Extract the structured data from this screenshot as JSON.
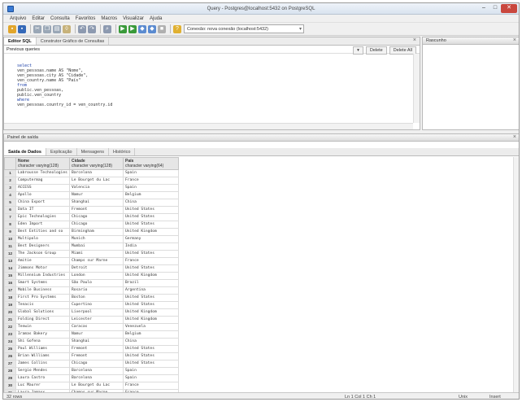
{
  "window": {
    "title": "Query - Postgres@localhost:5432 on PostgreSQL"
  },
  "menu": [
    "Arquivo",
    "Editar",
    "Consulta",
    "Favoritos",
    "Macros",
    "Visualizar",
    "Ajuda"
  ],
  "toolbar": {
    "connection": "Conexão: nova conexão (localhost:5432)"
  },
  "editor": {
    "header": "Editor SQL",
    "tabs": [
      "Editor SQL",
      "Construtor Gráfico de Consultas"
    ],
    "label": "Previous queries",
    "buttons": {
      "delete": "Delete",
      "delete_all": "Delete All"
    },
    "sql": [
      "select",
      "    ven_pessoas.name AS \"Nome\",",
      "    ven_pessoas.city AS \"Cidade\",",
      "    ven_country.name AS \"País\"",
      "from",
      "    public.ven_pessoas,",
      "    public.ven_country",
      "where",
      "    ven_pessoas.country_id = ven_country.id"
    ]
  },
  "scratch": {
    "header": "Rascunho"
  },
  "output": {
    "header": "Painel de saída",
    "tabs": [
      "Saída de Dados",
      "Explicação",
      "Mensagens",
      "Histórico"
    ],
    "columns": [
      {
        "name": "Nome",
        "type": "character varying(128)"
      },
      {
        "name": "Cidade",
        "type": "character varying(128)"
      },
      {
        "name": "País",
        "type": "character varying(64)"
      }
    ],
    "rows": [
      [
        "1",
        "Labrousse Technologies",
        "Barcelona",
        "Spain"
      ],
      [
        "2",
        "Computermag",
        "Le Bourget du Lac",
        "France"
      ],
      [
        "3",
        "ACCESS",
        "Valencia",
        "Spain"
      ],
      [
        "4",
        "Apollo",
        "Namur",
        "Belgium"
      ],
      [
        "5",
        "China Export",
        "Shanghai",
        "China"
      ],
      [
        "6",
        "Data IT",
        "Fremont",
        "United States"
      ],
      [
        "7",
        "Epic Technologies",
        "Chicago",
        "United States"
      ],
      [
        "8",
        "Eden Import",
        "Chicago",
        "United States"
      ],
      [
        "9",
        "Best Entities and so",
        "Birmingham",
        "United Kingdom"
      ],
      [
        "10",
        "Multipolo",
        "Munich",
        "Germany"
      ],
      [
        "11",
        "Best Designers",
        "Mumbai",
        "India"
      ],
      [
        "12",
        "The Jackson Group",
        "Miami",
        "United States"
      ],
      [
        "13",
        "Amitie",
        "Champs sur Marne",
        "France"
      ],
      [
        "14",
        "Jimmons Motor",
        "Detroit",
        "United States"
      ],
      [
        "15",
        "Millennium Industries",
        "London",
        "United Kingdom"
      ],
      [
        "16",
        "Smart Systems",
        "São Paulo",
        "Brazil"
      ],
      [
        "17",
        "Mobile Business",
        "Rosario",
        "Argentina"
      ],
      [
        "18",
        "First Pro Systems",
        "Boston",
        "United States"
      ],
      [
        "19",
        "Tenacis",
        "Cupertino",
        "United States"
      ],
      [
        "20",
        "Global Solutions",
        "Liverpool",
        "United Kingdom"
      ],
      [
        "21",
        "Folding Direct",
        "Leicester",
        "United Kingdom"
      ],
      [
        "22",
        "Tenwin",
        "Caracas",
        "Venezuela"
      ],
      [
        "23",
        "Iramas Bakery",
        "Namur",
        "Belgium"
      ],
      [
        "24",
        "Shi Gofena",
        "Shanghai",
        "China"
      ],
      [
        "25",
        "Paul Williams",
        "Fremont",
        "United States"
      ],
      [
        "26",
        "Brian Williams",
        "Fremont",
        "United States"
      ],
      [
        "27",
        "James Collins",
        "Chicago",
        "United States"
      ],
      [
        "28",
        "Sergio Mendes",
        "Barcelona",
        "Spain"
      ],
      [
        "29",
        "Laura Castro",
        "Barcelona",
        "Spain"
      ],
      [
        "30",
        "Luc Maurer",
        "Le Bourget du Lac",
        "France"
      ],
      [
        "31",
        "Laura Jamaux",
        "Champs sur Marne",
        "France"
      ],
      [
        "32",
        "Peter Ford",
        "Detroit",
        "United States"
      ]
    ]
  },
  "status": {
    "position": "Ln 1 Col 1 Ch 1",
    "timing": "32 rows",
    "mode": "Unix",
    "enc": "Insert"
  }
}
